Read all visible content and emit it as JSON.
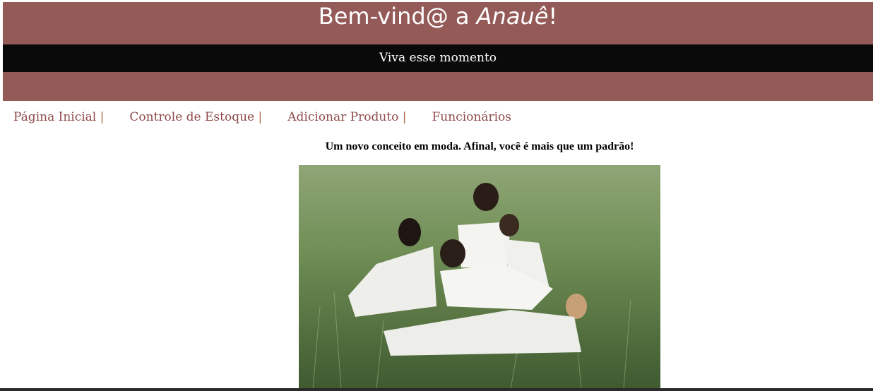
{
  "header": {
    "title_prefix": "Bem-vind@ a ",
    "title_brand": "Anauê",
    "title_suffix": "!",
    "subtitle": "Viva esse momento"
  },
  "nav": {
    "items": [
      {
        "label": "Página Inicial",
        "sep": " |"
      },
      {
        "label": "Controle de Estoque",
        "sep": " |"
      },
      {
        "label": "Adicionar Produto",
        "sep": " |"
      },
      {
        "label": "Funcionários",
        "sep": ""
      }
    ]
  },
  "tagline": "Um novo conceito em moda. Afinal, você é mais que um padrão!",
  "colors": {
    "header_bg": "#945a58",
    "band_bg": "#0a0a0a",
    "link": "#8e4a4a"
  }
}
